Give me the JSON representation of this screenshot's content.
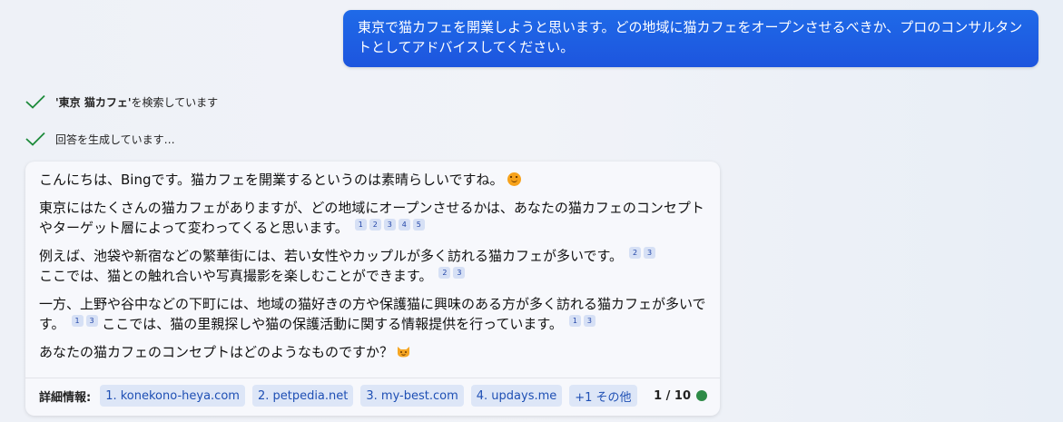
{
  "user_message": "東京で猫カフェを開業しようと思います。どの地域に猫カフェをオープンさせるべきか、プロのコンサルタントとしてアドバイスしてください。",
  "status": {
    "search_query": "'東京 猫カフェ'",
    "search_suffix": " を検索しています",
    "generating": "回答を生成しています…"
  },
  "answer": {
    "p1": "こんにちは、Bingです。猫カフェを開業するというのは素晴らしいですね。",
    "p2": "東京にはたくさんの猫カフェがありますが、どの地域にオープンさせるかは、あなたの猫カフェのコンセプトやターゲット層によって変わってくると思います。",
    "p2_cites": [
      "1",
      "2",
      "3",
      "4",
      "5"
    ],
    "p3a": "例えば、池袋や新宿などの繁華街には、若い女性やカップルが多く訪れる猫カフェが多いです。",
    "p3a_cites": [
      "2",
      "3"
    ],
    "p3b": "ここでは、猫との触れ合いや写真撮影を楽しむことができます。",
    "p3b_cites": [
      "2",
      "3"
    ],
    "p4a": "一方、上野や谷中などの下町には、地域の猫好きの方や保護猫に興味のある方が多く訪れる猫カフェが多いです。",
    "p4a_cites": [
      "1",
      "3"
    ],
    "p4b": "ここでは、猫の里親探しや猫の保護活動に関する情報提供を行っています。",
    "p4b_cites": [
      "1",
      "3"
    ],
    "p5": "あなたの猫カフェのコンセプトはどのようなものですか？"
  },
  "footer": {
    "label": "詳細情報:",
    "sources": [
      "1. konekono-heya.com",
      "2. petpedia.net",
      "3. my-best.com",
      "4. updays.me",
      "+1 その他"
    ],
    "page_count": "1 / 10"
  },
  "colors": {
    "user_bubble": "#1d5fe6",
    "check": "#1c8a3a",
    "citation_bg": "#d6e0f5",
    "chip_bg": "#dde6f7",
    "chip_text": "#1e4fb4",
    "status_dot": "#2e8b47"
  },
  "icons": {
    "status": "checkmark-icon",
    "emoji_1": "smiling-face-emoji",
    "emoji_2": "cat-face-emoji"
  }
}
